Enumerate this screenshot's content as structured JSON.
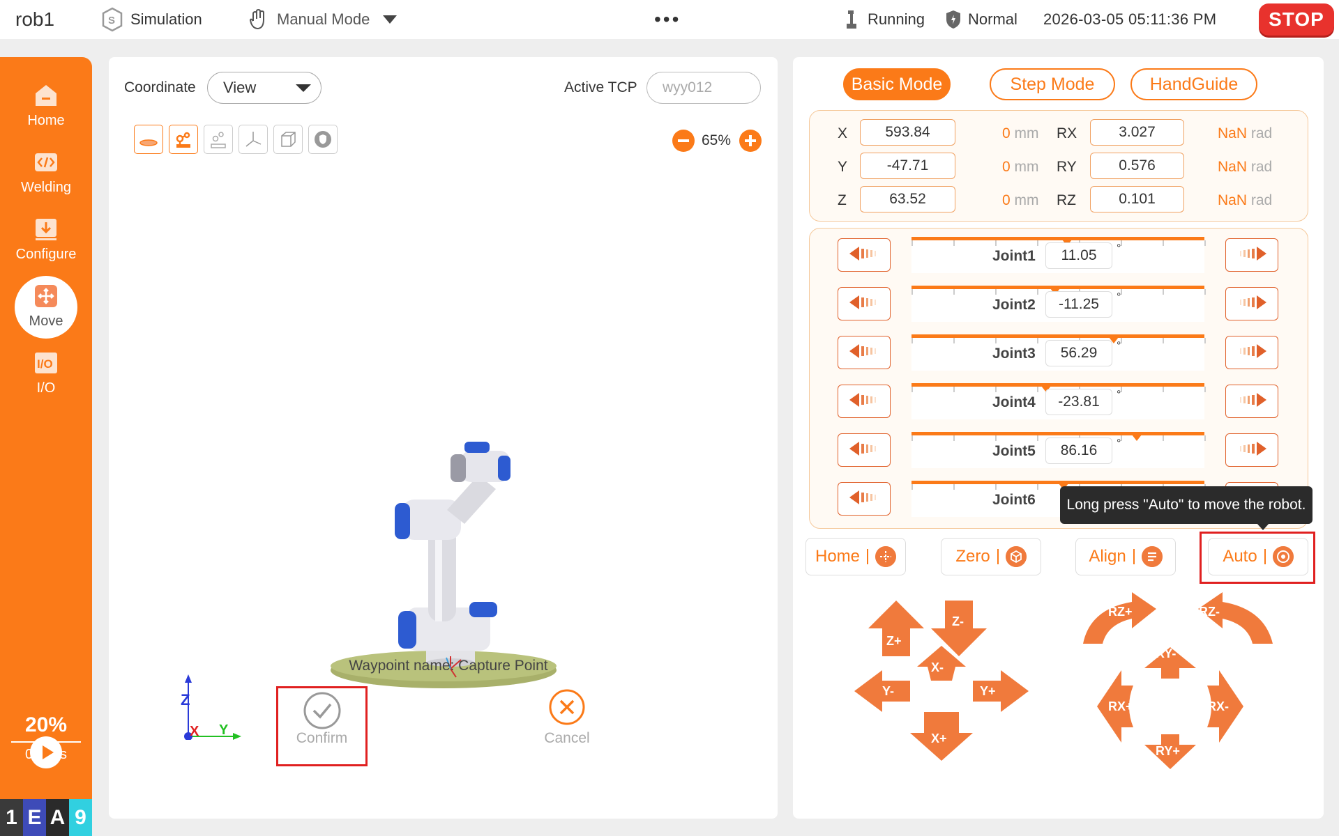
{
  "topbar": {
    "robot_name": "rob1",
    "simulation": "Simulation",
    "mode": "Manual Mode",
    "menu_dots": "•••",
    "status": "Running",
    "safety": "Normal",
    "datetime": "2026-03-05 05:11:36 PM",
    "stop": "STOP"
  },
  "sidebar": {
    "items": [
      {
        "label": "Home",
        "icon": "home-icon"
      },
      {
        "label": "Welding",
        "icon": "code-icon"
      },
      {
        "label": "Configure",
        "icon": "download-icon"
      },
      {
        "label": "Move",
        "icon": "move-icon",
        "active": true
      },
      {
        "label": "I/O",
        "icon": "io-icon"
      }
    ],
    "speed_percent": "20%",
    "speed_mms": "0mm/s",
    "badge": [
      "1",
      "E",
      "A",
      "9"
    ]
  },
  "view": {
    "coordinate_label": "Coordinate",
    "coordinate_value": "View",
    "active_tcp_label": "Active TCP",
    "active_tcp_placeholder": "wyy012",
    "zoom": "65%",
    "waypoint_label": "Waypoint name: Capture Point",
    "confirm": "Confirm",
    "cancel": "Cancel",
    "axis_labels": {
      "z": "Z",
      "x": "X",
      "y": "Y"
    }
  },
  "right": {
    "tabs": [
      "Basic Mode",
      "Step Mode",
      "HandGuide"
    ],
    "active_tab": "Basic Mode",
    "pose": [
      {
        "axis": "X",
        "value": "593.84",
        "offset": "0",
        "unit": "mm",
        "raxis": "RX",
        "rvalue": "3.027",
        "roffset": "NaN",
        "runit": "rad"
      },
      {
        "axis": "Y",
        "value": "-47.71",
        "offset": "0",
        "unit": "mm",
        "raxis": "RY",
        "rvalue": "0.576",
        "roffset": "NaN",
        "runit": "rad"
      },
      {
        "axis": "Z",
        "value": "63.52",
        "offset": "0",
        "unit": "mm",
        "raxis": "RZ",
        "rvalue": "0.101",
        "roffset": "NaN",
        "runit": "rad"
      }
    ],
    "joints": [
      {
        "name": "Joint1",
        "value": "11.05",
        "unit": "°",
        "level": 0.53
      },
      {
        "name": "Joint2",
        "value": "-11.25",
        "unit": "°",
        "level": 0.49
      },
      {
        "name": "Joint3",
        "value": "56.29",
        "unit": "°",
        "level": 0.69
      },
      {
        "name": "Joint4",
        "value": "-23.81",
        "unit": "°",
        "level": 0.46
      },
      {
        "name": "Joint5",
        "value": "86.16",
        "unit": "°",
        "level": 0.77
      },
      {
        "name": "Joint6",
        "value": "",
        "unit": "°",
        "level": 0.52
      }
    ],
    "tooltip": "Long press \"Auto\" to move the robot.",
    "actions": [
      "Home",
      "Zero",
      "Align",
      "Auto"
    ],
    "jog_linear": [
      "Z+",
      "Z-",
      "X-",
      "Y-",
      "Y+",
      "X+"
    ],
    "jog_rotary": [
      "RZ+",
      "RZ-",
      "RY-",
      "RX+",
      "RX-",
      "RY+"
    ]
  },
  "colors": {
    "accent": "#fb7a18",
    "stop": "#e8322d",
    "highlight": "#e02020",
    "robot_blue": "#2d5bd1"
  }
}
